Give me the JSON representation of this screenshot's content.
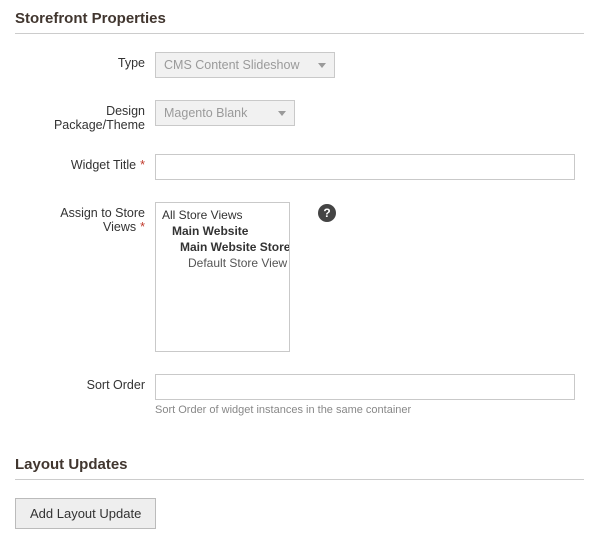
{
  "sections": {
    "storefront": {
      "title": "Storefront Properties",
      "fields": {
        "type": {
          "label": "Type",
          "value": "CMS Content Slideshow"
        },
        "theme": {
          "label": "Design Package/Theme",
          "value": "Magento Blank"
        },
        "widget_title": {
          "label": "Widget Title",
          "value": ""
        },
        "store_views": {
          "label": "Assign to Store Views",
          "options": [
            "All Store Views",
            "Main Website",
            "Main Website Store",
            "Default Store View"
          ]
        },
        "sort_order": {
          "label": "Sort Order",
          "value": "",
          "hint": "Sort Order of widget instances in the same container"
        }
      }
    },
    "layout_updates": {
      "title": "Layout Updates",
      "add_button": "Add Layout Update"
    }
  },
  "help_icon_glyph": "?"
}
